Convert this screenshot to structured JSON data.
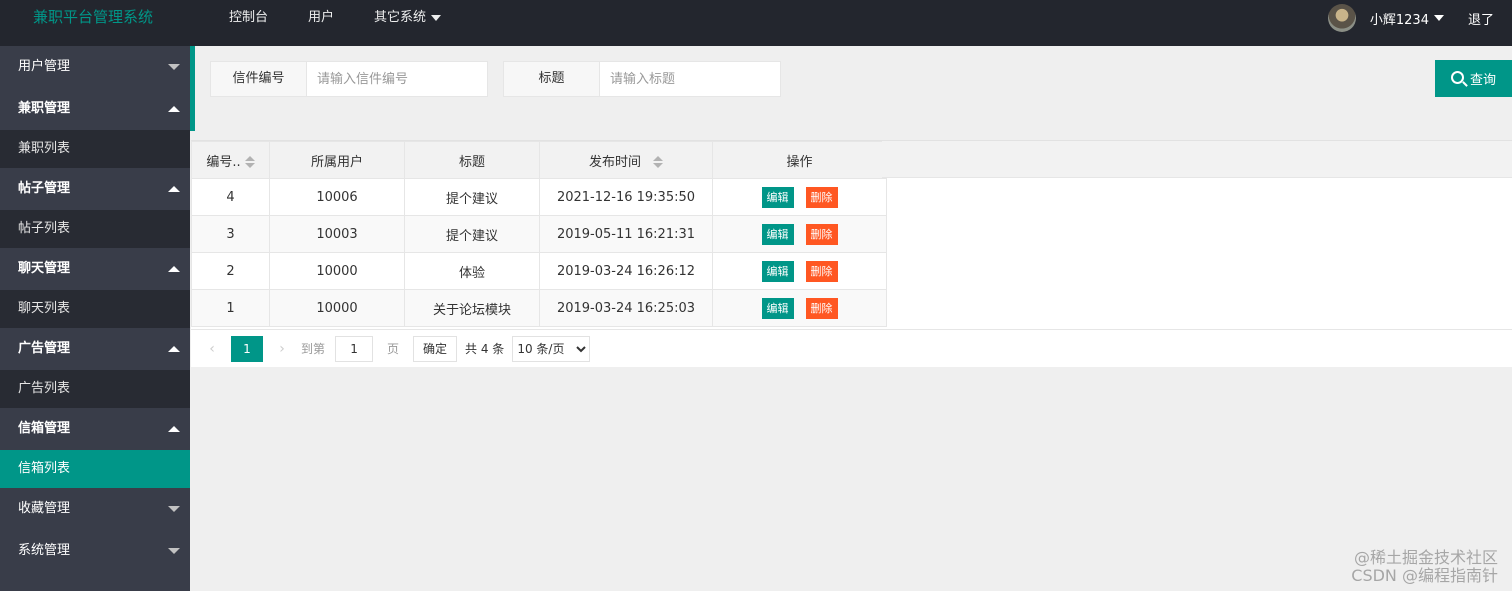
{
  "app": {
    "title": "兼职平台管理系统"
  },
  "top_nav": [
    {
      "label": "控制台"
    },
    {
      "label": "用户"
    },
    {
      "label": "其它系统"
    }
  ],
  "user": {
    "name": "小辉1234",
    "logout": "退了"
  },
  "sidebar": {
    "groups": [
      {
        "label": "用户管理",
        "expanded": false
      },
      {
        "label": "兼职管理",
        "expanded": true,
        "items": [
          {
            "label": "兼职列表"
          }
        ]
      },
      {
        "label": "帖子管理",
        "expanded": true,
        "items": [
          {
            "label": "帖子列表"
          }
        ]
      },
      {
        "label": "聊天管理",
        "expanded": true,
        "items": [
          {
            "label": "聊天列表"
          }
        ]
      },
      {
        "label": "广告管理",
        "expanded": true,
        "items": [
          {
            "label": "广告列表"
          }
        ]
      },
      {
        "label": "信箱管理",
        "expanded": true,
        "items": [
          {
            "label": "信箱列表",
            "active": true
          }
        ]
      },
      {
        "label": "收藏管理",
        "expanded": false
      },
      {
        "label": "系统管理",
        "expanded": false
      }
    ]
  },
  "search": {
    "field1": {
      "label": "信件编号",
      "placeholder": "请输入信件编号",
      "value": ""
    },
    "field2": {
      "label": "标题",
      "placeholder": "请输入标题",
      "value": ""
    },
    "query_label": "查询"
  },
  "table": {
    "columns": [
      "编号..",
      "所属用户",
      "标题",
      "发布时间",
      "操作"
    ],
    "rows": [
      {
        "id": "4",
        "user": "10006",
        "title": "提个建议",
        "time": "2021-12-16 19:35:50"
      },
      {
        "id": "3",
        "user": "10003",
        "title": "提个建议",
        "time": "2019-05-11 16:21:31"
      },
      {
        "id": "2",
        "user": "10000",
        "title": "体验",
        "time": "2019-03-24 16:26:12"
      },
      {
        "id": "1",
        "user": "10000",
        "title": "关于论坛模块",
        "time": "2019-03-24 16:25:03"
      }
    ],
    "edit_label": "编辑",
    "delete_label": "删除"
  },
  "pager": {
    "current": "1",
    "goto_prefix": "到第",
    "goto_value": "1",
    "goto_suffix": "页",
    "confirm": "确定",
    "total": "共 4 条",
    "page_size": "10 条/页"
  },
  "watermark": {
    "line1": "@稀土掘金技术社区",
    "line2": "CSDN @编程指南针"
  },
  "colors": {
    "accent": "#009688",
    "danger": "#ff5722",
    "header_bg": "#23262e",
    "sidebar_bg": "#393d49"
  }
}
